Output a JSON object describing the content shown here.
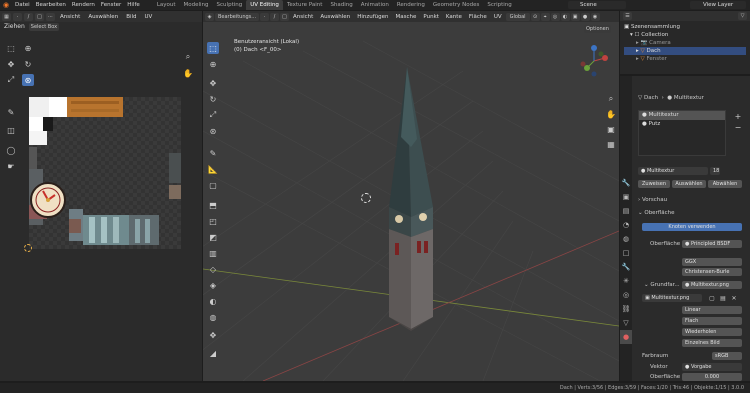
{
  "topbar": {
    "menus": [
      "Datei",
      "Bearbeiten",
      "Rendern",
      "Fenster",
      "Hilfe"
    ],
    "workspaces": [
      "Layout",
      "Modeling",
      "Sculpting",
      "UV Editing",
      "Texture Paint",
      "Shading",
      "Animation",
      "Rendering",
      "Geometry Nodes",
      "Scripting"
    ],
    "scene": "Scene",
    "view_layer": "View Layer"
  },
  "uv_editor": {
    "header_menus": [
      "Ansicht",
      "Auswählen",
      "Bild",
      "UV"
    ],
    "drag_label": "Ziehen",
    "drag_value": "Select Box"
  },
  "viewport": {
    "mode": "Bearbeitungs...",
    "header_menus": [
      "Ansicht",
      "Auswählen",
      "Hinzufügen",
      "Masche",
      "Punkt",
      "Kante",
      "Fläche",
      "UV"
    ],
    "transform": "Global",
    "options": "Optionen",
    "view_name": "Benutzeransicht (Lokal)",
    "object_name": "(0) Dach <F_00>"
  },
  "outliner": {
    "title": "Szenensammlung",
    "items": [
      "Collection",
      "Camera",
      "Dach",
      "Fenster",
      "Fenster"
    ]
  },
  "properties": {
    "breadcrumb_object": "Dach",
    "breadcrumb_material": "Multitextur",
    "material_slots": [
      "Multitextur",
      "Putz"
    ],
    "material_name": "Multitextur",
    "material_users": "18",
    "assign_buttons": [
      "Zuweisen",
      "Auswählen",
      "Abwählen"
    ],
    "preview_label": "Vorschau",
    "surface_label": "Oberfläche",
    "use_nodes": "Knoten verwenden",
    "surface_field_label": "Oberfläche",
    "surface_shader": "Principled BSDF",
    "distribution": "GGX",
    "subsurface": "Christensen-Burle",
    "basecolor_label": "Grundfar...",
    "basecolor_tex": "Multitextur.png",
    "image_name": "Multitextur.png",
    "interpolation": "Linear",
    "projection": "Flach",
    "extension": "Wiederholen",
    "source": "Einzelnes Bild",
    "colorspace_label": "Farbraum",
    "colorspace": "sRGB",
    "vector_label": "Vektor",
    "vector_value": "Vorgabe",
    "surface_value_label": "Oberfläche",
    "surface_value": "0.000"
  },
  "statusbar": {
    "text": "Dach | Verts:3/56 | Edges:3/59 | Faces:1/20 | Tris:46 | Objekte:1/15 | 3.0.0"
  },
  "colors": {
    "accent": "#4772b3",
    "orange": "#f5792a"
  }
}
